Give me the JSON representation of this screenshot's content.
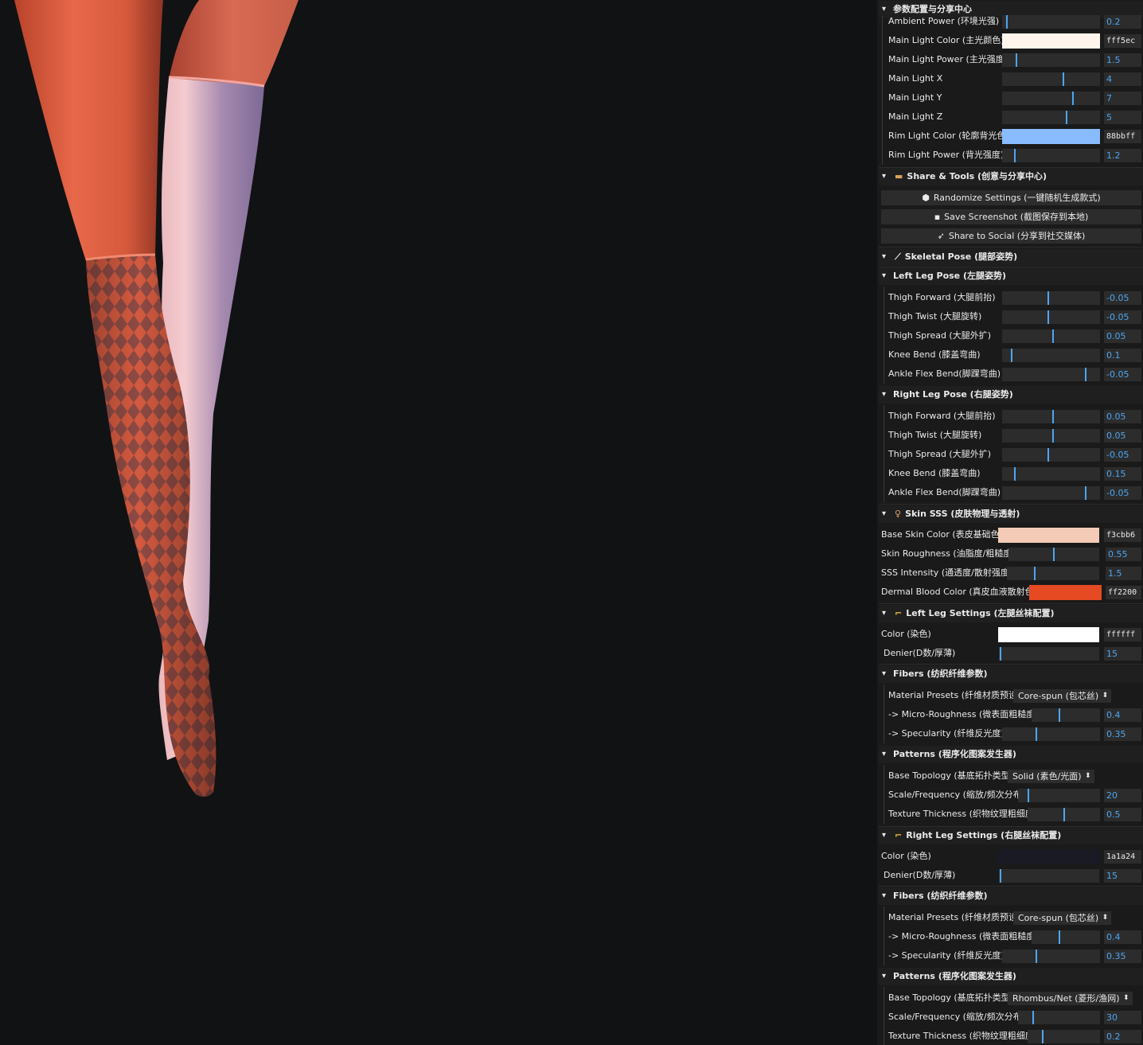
{
  "panel": {
    "main_title": "参数配置与分享中心",
    "lighting": [
      {
        "label": "Ambient Power (环境光强)",
        "value": "0.2",
        "fraction": 0.04
      },
      {
        "label": "Main Light Color (主光颜色)",
        "hex": "fff5ec",
        "color": "#fff5ec"
      },
      {
        "label": "Main Light Power (主光强度)",
        "value": "1.5",
        "fraction": 0.14
      },
      {
        "label": "Main Light X",
        "value": "4",
        "fraction": 0.63
      },
      {
        "label": "Main Light Y",
        "value": "7",
        "fraction": 0.73
      },
      {
        "label": "Main Light Z",
        "value": "5",
        "fraction": 0.66
      },
      {
        "label": "Rim Light Color (轮廓背光色)",
        "hex": "88bbff",
        "color": "#88bbff"
      },
      {
        "label": "Rim Light Power (背光强度)",
        "value": "1.2",
        "fraction": 0.12
      }
    ],
    "share": {
      "title": "Share & Tools (创意与分享中心)",
      "buttons": [
        {
          "icon": "dice-icon",
          "label": "Randomize Settings (一键随机生成款式)"
        },
        {
          "icon": "save-icon",
          "label": "Save Screenshot (截图保存到本地)"
        },
        {
          "icon": "rocket-icon",
          "label": "Share to Social (分享到社交媒体)"
        }
      ]
    },
    "pose": {
      "title": "Skeletal Pose (腿部姿势)",
      "left_title": "Left Leg Pose (左腿姿势)",
      "left": [
        {
          "label": "Thigh Forward (大腿前抬)",
          "value": "-0.05",
          "fraction": 0.47
        },
        {
          "label": "Thigh Twist (大腿旋转)",
          "value": "-0.05",
          "fraction": 0.47
        },
        {
          "label": "Thigh Spread (大腿外扩)",
          "value": "0.05",
          "fraction": 0.52
        },
        {
          "label": "Knee Bend (膝盖弯曲)",
          "value": "0.1",
          "fraction": 0.09
        },
        {
          "label": "Ankle Flex Bend(脚踝弯曲)",
          "value": "-0.05",
          "fraction": 0.86
        }
      ],
      "right_title": "Right Leg Pose (右腿姿势)",
      "right": [
        {
          "label": "Thigh Forward (大腿前抬)",
          "value": "0.05",
          "fraction": 0.52
        },
        {
          "label": "Thigh Twist (大腿旋转)",
          "value": "0.05",
          "fraction": 0.52
        },
        {
          "label": "Thigh Spread (大腿外扩)",
          "value": "-0.05",
          "fraction": 0.47
        },
        {
          "label": "Knee Bend (膝盖弯曲)",
          "value": "0.15",
          "fraction": 0.12
        },
        {
          "label": "Ankle Flex Bend(脚踝弯曲)",
          "value": "-0.05",
          "fraction": 0.86
        }
      ]
    },
    "skin": {
      "title": "Skin SSS (皮肤物理与透射)",
      "base_color_label": "Base Skin Color (表皮基础色)",
      "base_color_hex": "f3cbb6",
      "base_color": "#f3cbb6",
      "roughness_label": "Skin Roughness (油脂度/粗糙度)",
      "roughness_value": "0.55",
      "roughness_fraction": 0.5,
      "sss_label": "SSS Intensity (通透度/散射强度)",
      "sss_value": "1.5",
      "sss_fraction": 0.3,
      "blood_label": "Dermal Blood Color (真皮血液散射色)",
      "blood_hex": "ff2200",
      "blood_color": "#e54a22"
    },
    "left_leg": {
      "title": "Left Leg Settings (左腿丝袜配置)",
      "color_label": "Color (染色)",
      "color_hex": "ffffff",
      "color": "#ffffff",
      "denier_label": "Denier(D数/厚薄)",
      "denier_value": "15",
      "denier_fraction": 0.01,
      "fibers_title": "Fibers (纺织纤维参数)",
      "material_label": "Material Presets (纤维材质预设)",
      "material_value": "Core-spun (包芯丝)",
      "micro_label": "-> Micro-Roughness (微表面粗糙度)",
      "micro_value": "0.4",
      "micro_fraction": 0.4,
      "spec_label": "-> Specularity (纤维反光度)",
      "spec_value": "0.35",
      "spec_fraction": 0.35,
      "patterns_title": "Patterns (程序化图案发生器)",
      "topology_label": "Base Topology (基底拓扑类型)",
      "topology_value": "Solid (素色/光面)",
      "scale_label": "Scale/Frequency (缩放/频次分布)",
      "scale_value": "20",
      "scale_fraction": 0.12,
      "thick_label": "Texture Thickness (织物纹理粗细度)",
      "thick_value": "0.5",
      "thick_fraction": 0.5
    },
    "right_leg": {
      "title": "Right Leg Settings (右腿丝袜配置)",
      "color_label": "Color (染色)",
      "color_hex": "1a1a24",
      "color": "#1a1a24",
      "denier_label": "Denier(D数/厚薄)",
      "denier_value": "15",
      "denier_fraction": 0.01,
      "fibers_title": "Fibers (纺织纤维参数)",
      "material_label": "Material Presets (纤维材质预设)",
      "material_value": "Core-spun (包芯丝)",
      "micro_label": "-> Micro-Roughness (微表面粗糙度)",
      "micro_value": "0.4",
      "micro_fraction": 0.4,
      "spec_label": "-> Specularity (纤维反光度)",
      "spec_value": "0.35",
      "spec_fraction": 0.35,
      "patterns_title": "Patterns (程序化图案发生器)",
      "topology_label": "Base Topology (基底拓扑类型)",
      "topology_value": "Rhombus/Net (菱形/渔网)",
      "scale_label": "Scale/Frequency (缩放/频次分布)",
      "scale_value": "30",
      "scale_fraction": 0.18,
      "thick_label": "Texture Thickness (织物纹理粗细度)",
      "thick_value": "0.2",
      "thick_fraction": 0.2
    }
  },
  "colors": {
    "accent": "#4da6f2",
    "panel_bg": "#1a1a1a",
    "canvas_bg": "#111214"
  }
}
